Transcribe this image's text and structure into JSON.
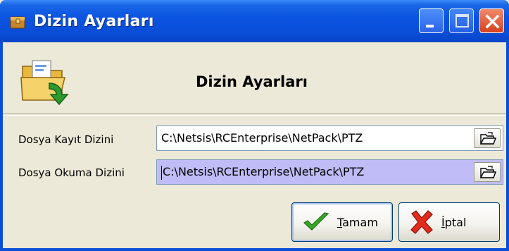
{
  "window": {
    "title": "Dizin Ayarları",
    "controls": {
      "minimize_icon": "minimize-icon",
      "maximize_icon": "maximize-icon",
      "close_icon": "close-icon"
    }
  },
  "header": {
    "title": "Dizin Ayarları",
    "icon": "folder-open-arrow-icon"
  },
  "form": {
    "save_dir": {
      "label": "Dosya Kayıt Dizini",
      "value": "C:\\Netsis\\RCEnterprise\\NetPack\\PTZ"
    },
    "read_dir": {
      "label": "Dosya Okuma Dizini",
      "value": ":\\Netsis\\RCEnterprise\\NetPack\\PTZ",
      "value_prefix": "C"
    }
  },
  "buttons": {
    "ok": {
      "mnemonic": "T",
      "rest": "amam",
      "icon": "checkmark-icon"
    },
    "cancel": {
      "mnemonic": "İ",
      "rest": "ptal",
      "icon": "red-x-icon"
    }
  },
  "colors": {
    "titlebar": "#0b55e2",
    "dialog_bg": "#ece9d8",
    "focused_field_bg": "#bfbcf7",
    "close_button": "#d6401c"
  }
}
